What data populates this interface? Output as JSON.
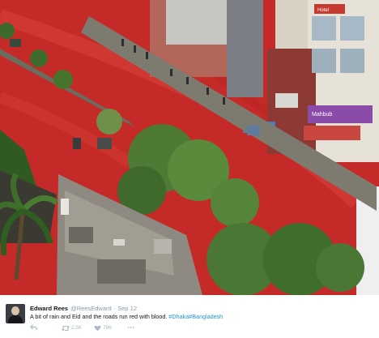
{
  "photo": {
    "signs": [
      "Hotel",
      "Mahbub"
    ]
  },
  "tweet": {
    "author_name": "Edward Rees",
    "author_handle": "@ReesEdward",
    "date": "· Sep 12",
    "text": "A bit of rain and Eid and the roads run red with blood.",
    "hashtag_1": "#Dhaka",
    "hashtag_2": "#Bangladesh",
    "retweet_count": "2.5K",
    "like_count": "796"
  },
  "icons": [
    "reply-icon",
    "retweet-icon",
    "like-icon",
    "more-icon"
  ],
  "colors": {
    "flood_red": "#c9302c",
    "hashtag_blue": "#1b95e0",
    "muted_gray": "#8899a6"
  }
}
